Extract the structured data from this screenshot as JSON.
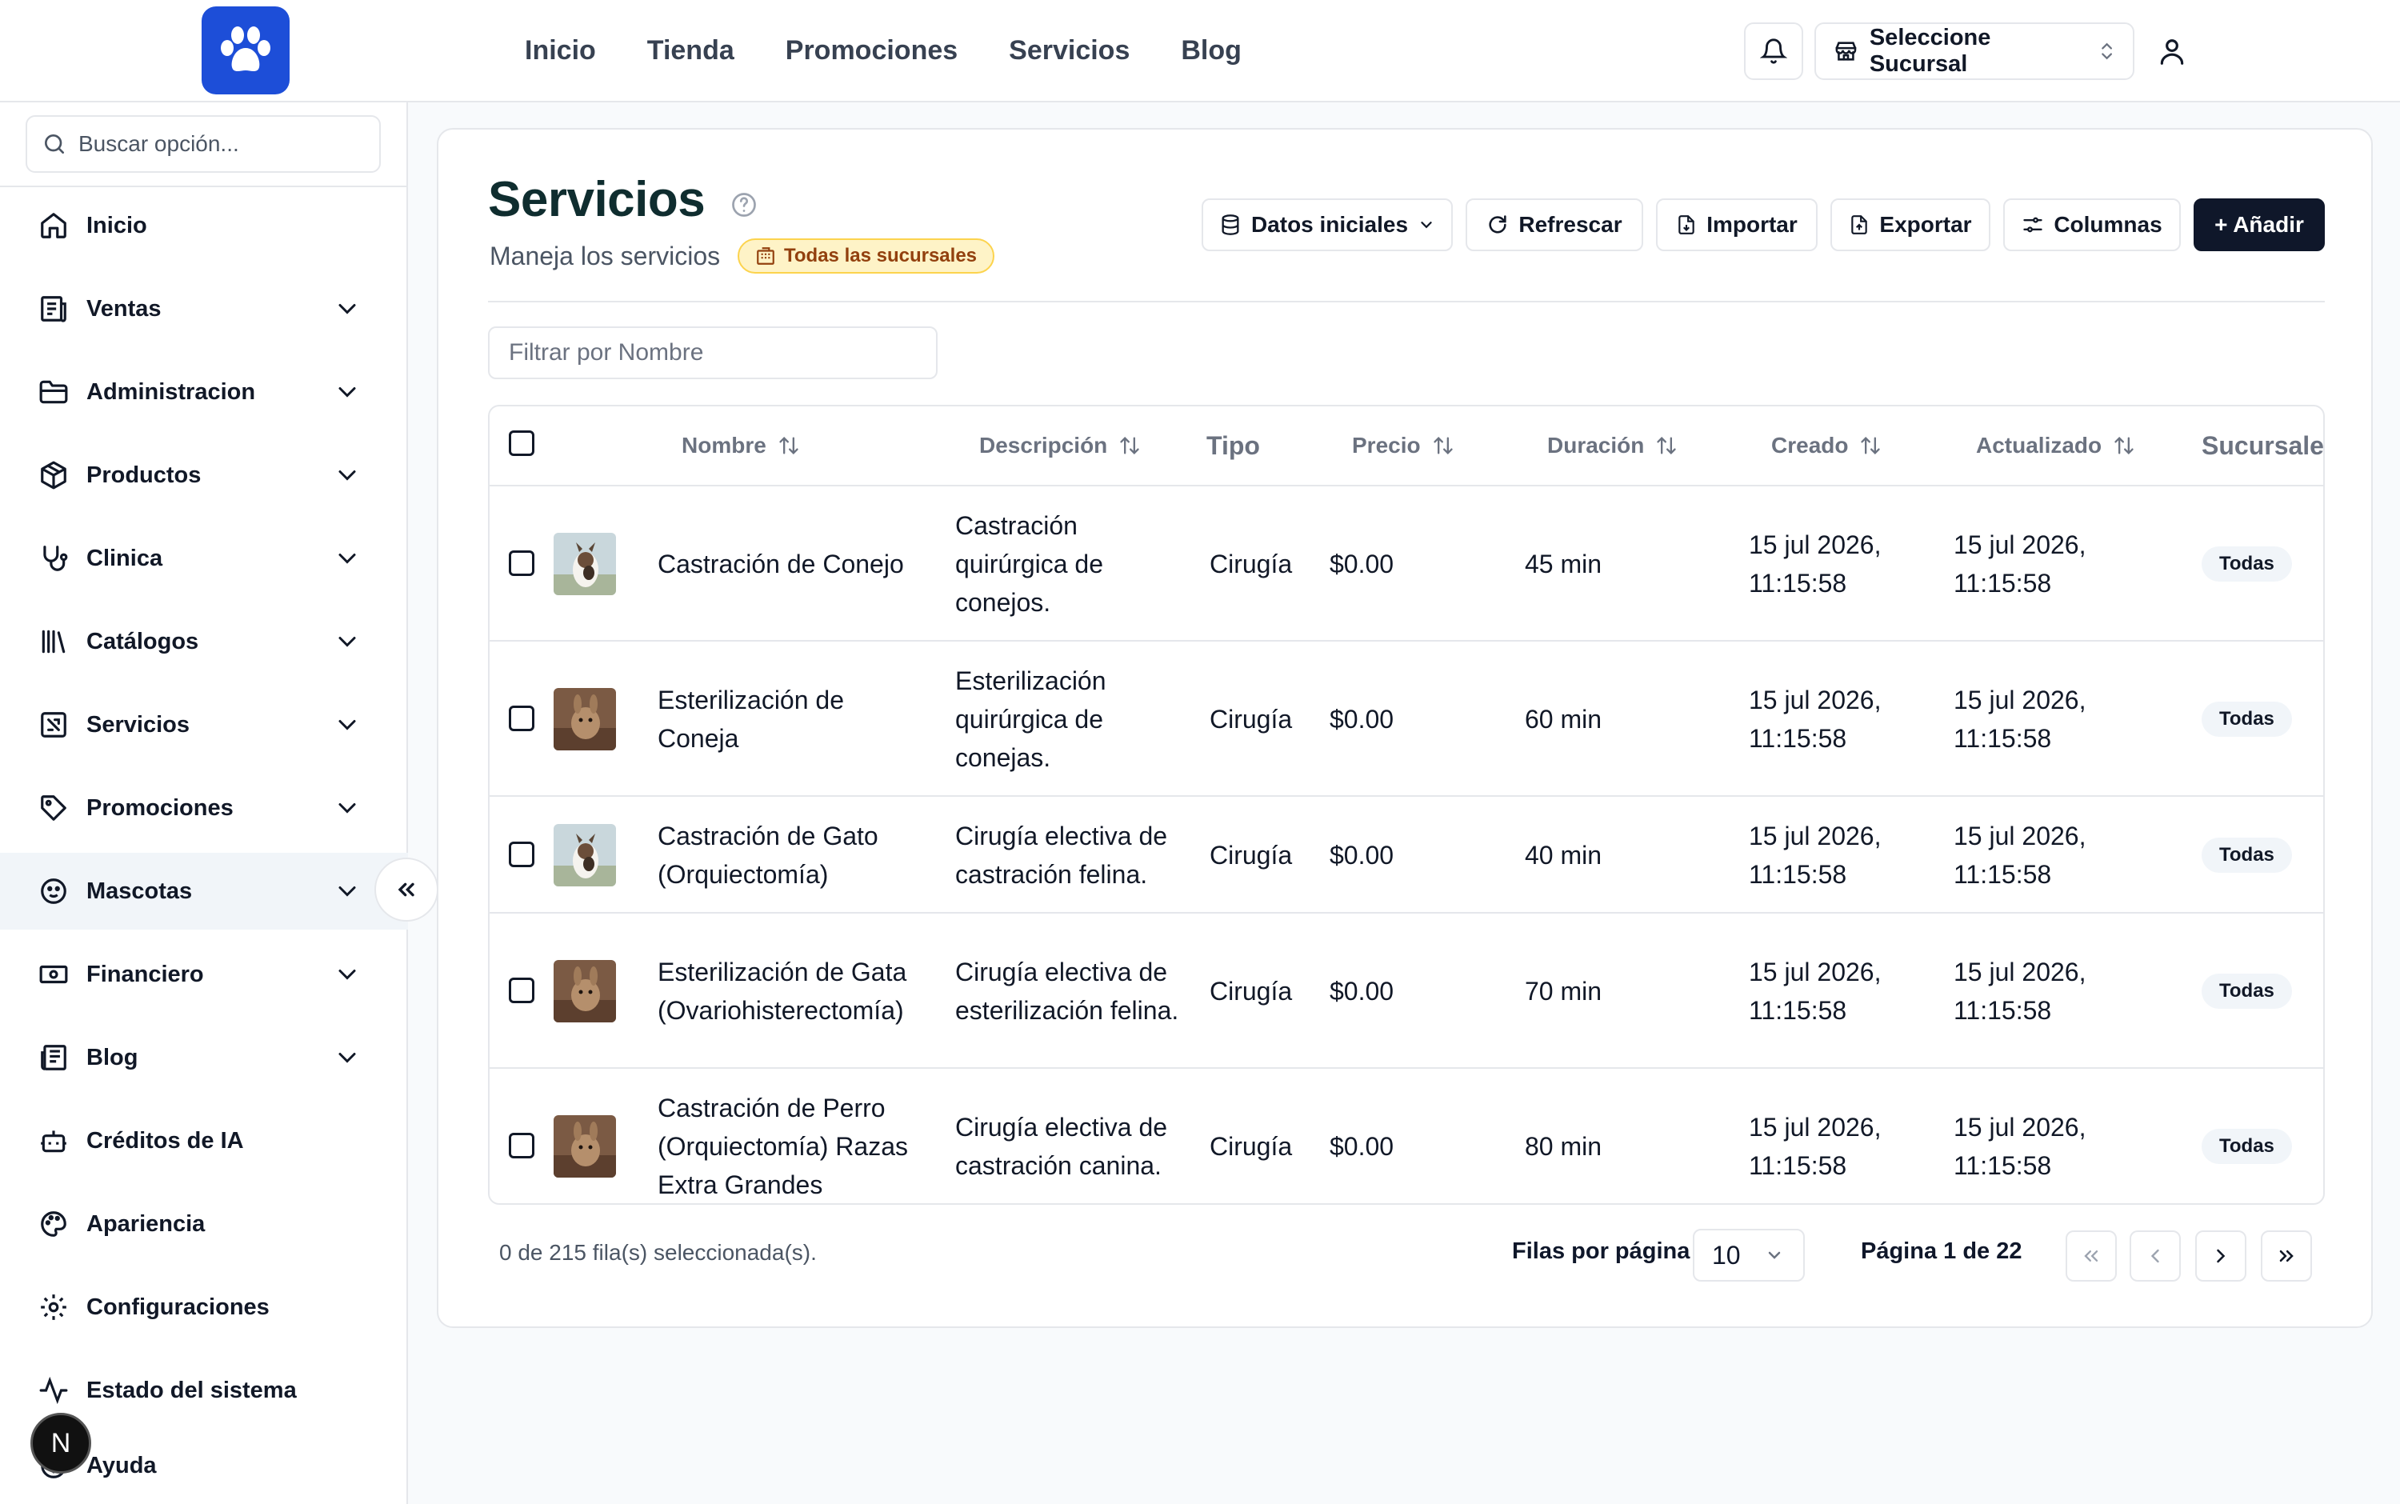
{
  "topnav": {
    "items": [
      "Inicio",
      "Tienda",
      "Promociones",
      "Servicios",
      "Blog"
    ]
  },
  "branch": {
    "label": "Seleccione Sucursal"
  },
  "sidebar": {
    "search_placeholder": "Buscar opción...",
    "items": [
      {
        "label": "Inicio",
        "icon": "home-icon"
      },
      {
        "label": "Ventas",
        "icon": "receipt-icon"
      },
      {
        "label": "Administracion",
        "icon": "folder-icon"
      },
      {
        "label": "Productos",
        "icon": "package-icon"
      },
      {
        "label": "Clinica",
        "icon": "stethoscope-icon"
      },
      {
        "label": "Catálogos",
        "icon": "library-icon"
      },
      {
        "label": "Servicios",
        "icon": "service-icon"
      },
      {
        "label": "Promociones",
        "icon": "tag-icon"
      },
      {
        "label": "Mascotas",
        "icon": "paw-icon"
      },
      {
        "label": "Financiero",
        "icon": "banknote-icon"
      },
      {
        "label": "Blog",
        "icon": "newspaper-icon"
      },
      {
        "label": "Créditos de IA",
        "icon": "bot-icon"
      },
      {
        "label": "Apariencia",
        "icon": "palette-icon"
      },
      {
        "label": "Configuraciones",
        "icon": "gear-icon"
      },
      {
        "label": "Estado del sistema",
        "icon": "activity-icon"
      },
      {
        "label": "Ayuda",
        "icon": "help-icon"
      }
    ]
  },
  "page": {
    "title": "Servicios",
    "subtitle": "Maneja los servicios",
    "scope_badge": "Todas las sucursales",
    "filter_placeholder": "Filtrar por Nombre"
  },
  "toolbar": {
    "initial_data": "Datos iniciales",
    "refresh": "Refrescar",
    "import": "Importar",
    "export": "Exportar",
    "columns": "Columnas",
    "add": "+ Añadir"
  },
  "table": {
    "headers": {
      "name": "Nombre",
      "description": "Descripción",
      "type": "Tipo",
      "price": "Precio",
      "duration": "Duración",
      "created": "Creado",
      "updated": "Actualizado",
      "branches": "Sucursale"
    },
    "rows": [
      {
        "name": "Castración de Conejo",
        "description": "Castración quirúrgica de conejos.",
        "type": "Cirugía",
        "price": "$0.00",
        "duration": "45 min",
        "created": "15 jul 2026, 11:15:58",
        "updated": "15 jul 2026, 11:15:58",
        "branch": "Todas"
      },
      {
        "name": "Esterilización de Coneja",
        "description": "Esterilización quirúrgica de conejas.",
        "type": "Cirugía",
        "price": "$0.00",
        "duration": "60 min",
        "created": "15 jul 2026, 11:15:58",
        "updated": "15 jul 2026, 11:15:58",
        "branch": "Todas"
      },
      {
        "name": "Castración de Gato (Orquiectomía)",
        "description": "Cirugía electiva de castración felina.",
        "type": "Cirugía",
        "price": "$0.00",
        "duration": "40 min",
        "created": "15 jul 2026, 11:15:58",
        "updated": "15 jul 2026, 11:15:58",
        "branch": "Todas"
      },
      {
        "name": "Esterilización de Gata (Ovariohisterectomía)",
        "description": "Cirugía electiva de esterilización felina.",
        "type": "Cirugía",
        "price": "$0.00",
        "duration": "70 min",
        "created": "15 jul 2026, 11:15:58",
        "updated": "15 jul 2026, 11:15:58",
        "branch": "Todas"
      },
      {
        "name": "Castración de Perro (Orquiectomía) Razas Extra Grandes",
        "description": "Cirugía electiva de castración canina.",
        "type": "Cirugía",
        "price": "$0.00",
        "duration": "80 min",
        "created": "15 jul 2026, 11:15:58",
        "updated": "15 jul 2026, 11:15:58",
        "branch": "Todas"
      }
    ]
  },
  "footer": {
    "selection": "0 de 215 fila(s) seleccionada(s).",
    "rows_per_page_label": "Filas por página",
    "rows_per_page": "10",
    "page_info": "Página 1 de 22"
  },
  "colors": {
    "brand": "#1d4ed8",
    "primary_button": "#0f172a",
    "badge_bg": "#fef3c7",
    "badge_text": "#92400e"
  }
}
